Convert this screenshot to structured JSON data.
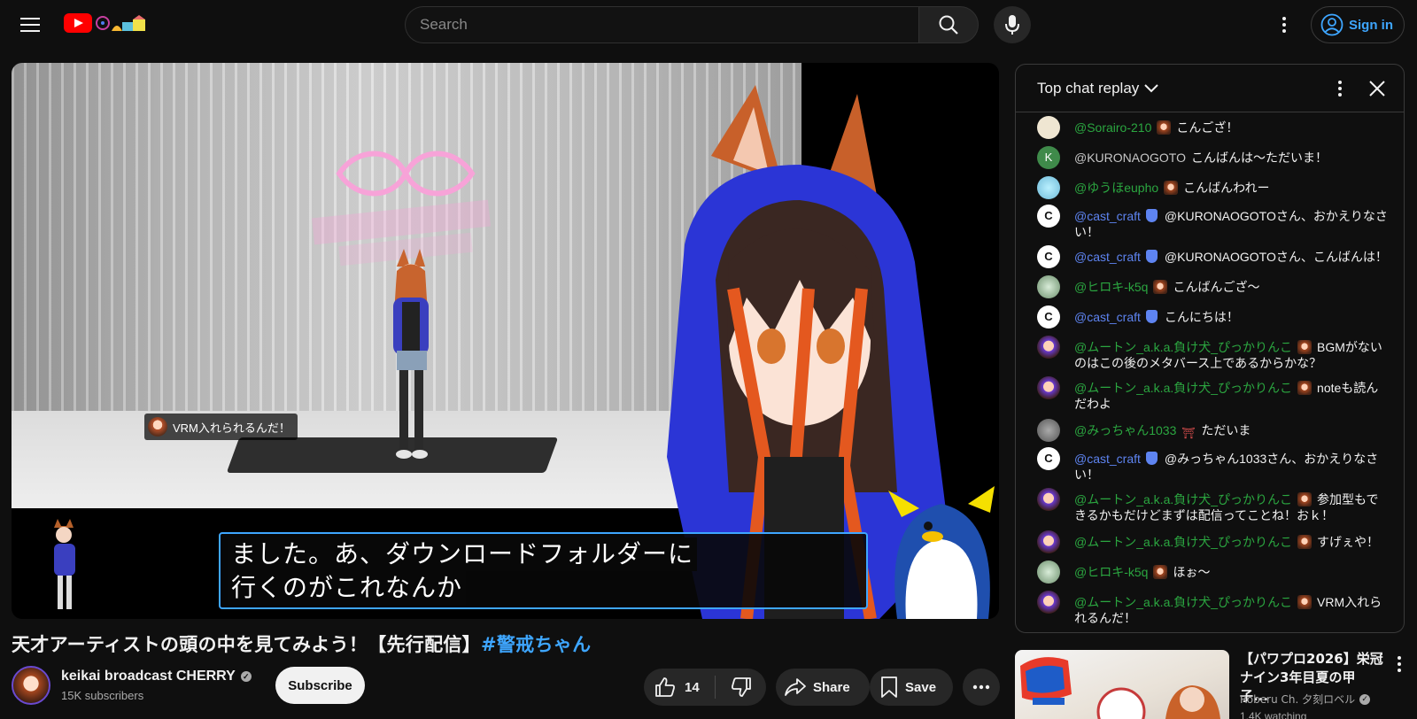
{
  "header": {
    "search_placeholder": "Search",
    "sign_in_label": "Sign in"
  },
  "player": {
    "overlay_message": "VRM入れられるんだ！",
    "caption_line1": "ました。あ、ダウンロードフォルダーに",
    "caption_line2": "行くのがこれなんか"
  },
  "video": {
    "title": "天才アーティストの頭の中を見てみよう！【先行配信】",
    "hashtag": "#警戒ちゃん",
    "channel_name": "keikai broadcast CHERRY",
    "subscribers": "15K subscribers",
    "subscribe_label": "Subscribe",
    "like_count": "14",
    "share_label": "Share",
    "save_label": "Save"
  },
  "chat": {
    "title": "Top chat replay",
    "messages": [
      {
        "author": "@Sorairo-210",
        "text": "こんござ！"
      },
      {
        "author": "@KURONAOGOTO",
        "text": "こんばんは〜ただいま！",
        "avatar_letter": "K"
      },
      {
        "author": "@ゆうほeupho",
        "text": "こんばんわれー"
      },
      {
        "author": "@cast_craft",
        "text": "@KURONAOGOTOさん、おかえりなさい！"
      },
      {
        "author": "@cast_craft",
        "text": "@KURONAOGOTOさん、こんばんは！"
      },
      {
        "author": "@ヒロキ-k5q",
        "text": "こんばんござ〜"
      },
      {
        "author": "@cast_craft",
        "text": "こんにちは！"
      },
      {
        "author": "@ムートン_a.k.a.負け犬_ぴっかりんこ",
        "text": "BGMがないのはこの後のメタバース上であるからかな？"
      },
      {
        "author": "@ムートン_a.k.a.負け犬_ぴっかりんこ",
        "text": "noteも読んだわよ"
      },
      {
        "author": "@みっちゃん1033",
        "text": "ただいま"
      },
      {
        "author": "@cast_craft",
        "text": "@みっちゃん1033さん、おかえりなさい！"
      },
      {
        "author": "@ムートン_a.k.a.負け犬_ぴっかりんこ",
        "text": "参加型もできるかもだけどまずは配信ってことね！おｋ！"
      },
      {
        "author": "@ムートン_a.k.a.負け犬_ぴっかりんこ",
        "text": "すげぇや！"
      },
      {
        "author": "@ヒロキ-k5q",
        "text": "ほぉ〜"
      },
      {
        "author": "@ムートン_a.k.a.負け犬_ぴっかりんこ",
        "text": "VRM入れられるんだ！"
      }
    ]
  },
  "recommended": {
    "title": "【パワプロ2026】栄冠ナイン3年目夏の甲子...",
    "channel": "Roberu Ch. 夕刻ロベル",
    "views": "1.4K watching"
  },
  "colors": {
    "background": "#0f0f0f",
    "accent_blue": "#3ea6ff",
    "chat_member_green": "#2ba640",
    "moderator_blue": "#5e84f1",
    "youtube_red": "#ff0000"
  }
}
